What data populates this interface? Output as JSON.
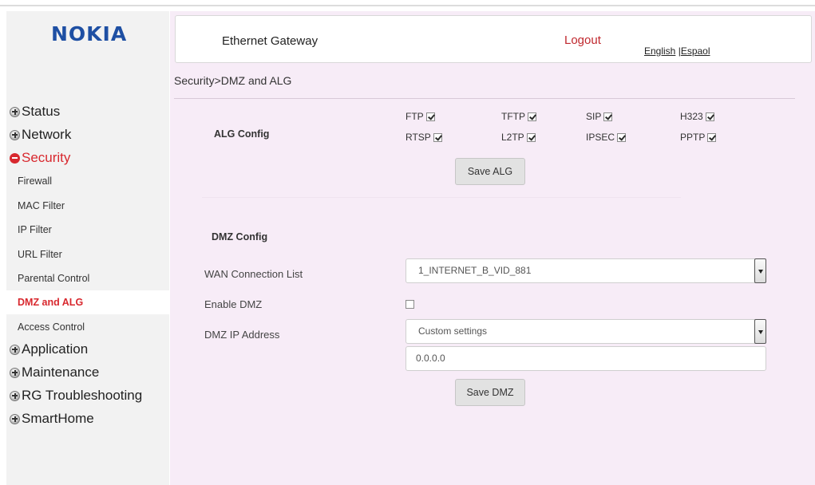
{
  "brand": {
    "logo_text": "NOKIA",
    "color": "#1e4fa3"
  },
  "header": {
    "title": "Ethernet Gateway",
    "logout_label": "Logout",
    "lang_english": "English",
    "lang_separator": "|",
    "lang_spanish": "Espaol"
  },
  "breadcrumb": "Security>DMZ and ALG",
  "sidebar": {
    "status": "Status",
    "network": "Network",
    "security": "Security",
    "security_items": [
      "Firewall",
      "MAC Filter",
      "IP Filter",
      "URL Filter",
      "Parental Control",
      "DMZ and ALG",
      "Access Control"
    ],
    "application": "Application",
    "maintenance": "Maintenance",
    "rg_troubleshooting": "RG Troubleshooting",
    "smarthome": "SmartHome"
  },
  "alg": {
    "title": "ALG Config",
    "items": [
      {
        "label": "FTP",
        "checked": true
      },
      {
        "label": "TFTP",
        "checked": true
      },
      {
        "label": "SIP",
        "checked": true
      },
      {
        "label": "H323",
        "checked": true
      },
      {
        "label": "RTSP",
        "checked": true
      },
      {
        "label": "L2TP",
        "checked": true
      },
      {
        "label": "IPSEC",
        "checked": true
      },
      {
        "label": "PPTP",
        "checked": true
      }
    ],
    "save_label": "Save ALG"
  },
  "dmz": {
    "title": "DMZ Config",
    "wan_label": "WAN Connection List",
    "wan_value": "1_INTERNET_B_VID_881",
    "enable_label": "Enable DMZ",
    "enable_checked": false,
    "ip_label": "DMZ IP Address",
    "ip_mode": "Custom settings",
    "ip_value": "0.0.0.0",
    "save_label": "Save DMZ"
  },
  "colors": {
    "accent_red": "#d8282e",
    "content_bg": "#f7ecf7",
    "sidebar_bg": "#f2f2f2"
  }
}
